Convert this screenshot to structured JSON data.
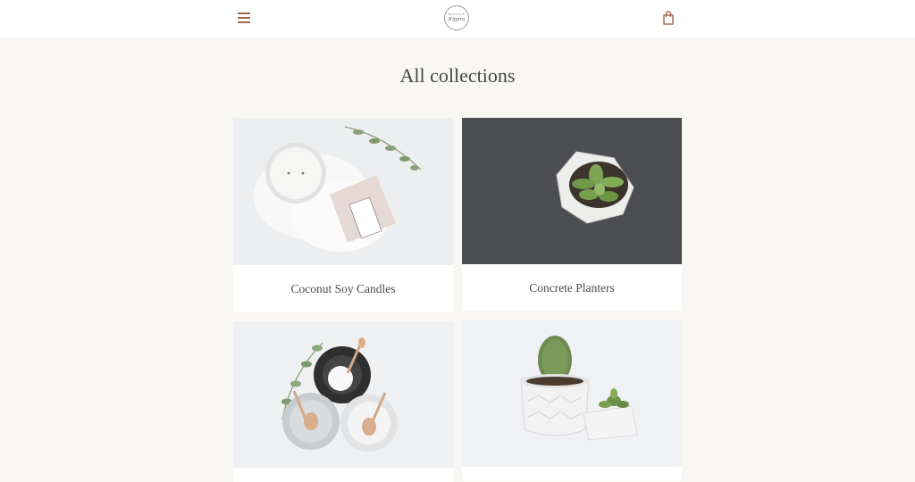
{
  "header": {
    "logo_small": "BOUTIQUE",
    "logo_main": "Kippra"
  },
  "page_title": "All collections",
  "collections": [
    {
      "label": "Coconut Soy Candles"
    },
    {
      "label": "Concrete Planters"
    },
    {
      "label": ""
    },
    {
      "label": ""
    }
  ],
  "colors": {
    "accent": "#a0664e",
    "page_background": "#f8f7f3",
    "card_background": "#ffffff"
  }
}
